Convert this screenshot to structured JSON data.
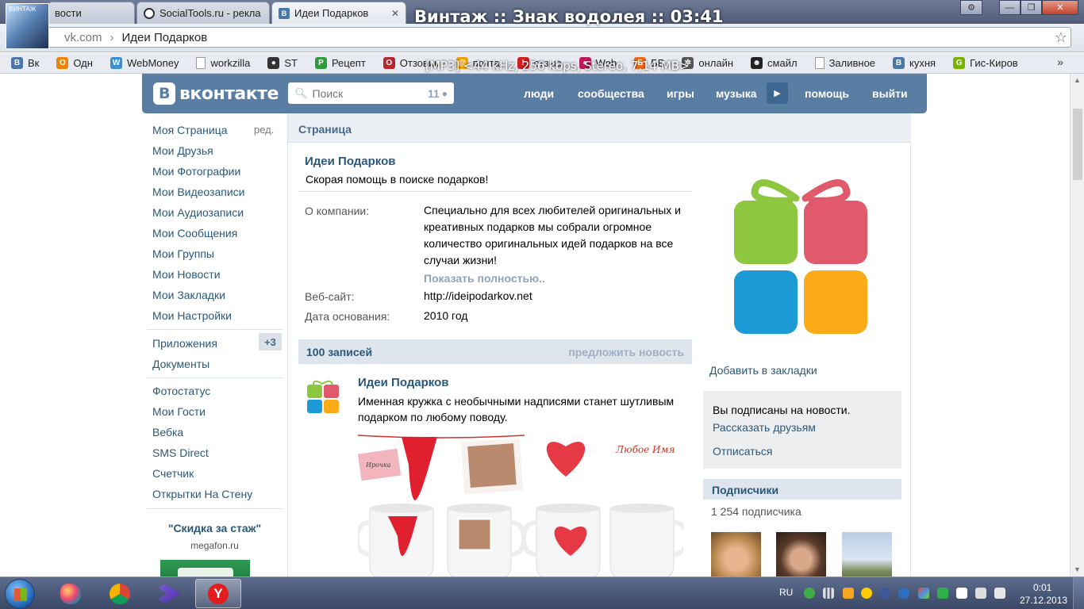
{
  "player": {
    "title": "Винтаж :: Знак водолея :: 03:41",
    "info": "[MP3] <44 kHz, 256 kbps, Stereo, 7,14 MB>",
    "cover_text": "ВИНТАЖ"
  },
  "browser": {
    "tabs": [
      {
        "label": "вости",
        "active": false
      },
      {
        "label": "SocialTools.ru - рекла",
        "active": false
      },
      {
        "label": "Идеи Подарков",
        "active": true
      }
    ],
    "address": {
      "host": "vk.com",
      "separator": "›",
      "page_title": "Идеи Подарков"
    },
    "bookmarks": [
      {
        "label": "Вк",
        "icon": "vk-icon",
        "color": "#4a76a8",
        "glyph": "В"
      },
      {
        "label": "Одн",
        "icon": "ok-icon",
        "color": "#ee8208",
        "glyph": "О"
      },
      {
        "label": "WebMoney",
        "icon": "webmoney-icon",
        "color": "#3a8fd0",
        "glyph": "W"
      },
      {
        "label": "workzilla",
        "icon": "page-icon",
        "color": "#ffffff",
        "glyph": ""
      },
      {
        "label": "ST",
        "icon": "st-icon",
        "color": "#333333",
        "glyph": "●"
      },
      {
        "label": "Рецепт",
        "icon": "recipe-icon",
        "color": "#2e9c3c",
        "glyph": "Р"
      },
      {
        "label": "Отзовик",
        "icon": "otzovik-icon",
        "color": "#b5282e",
        "glyph": "О"
      },
      {
        "label": "почта",
        "icon": "mail-icon",
        "color": "#f0a000",
        "glyph": "@"
      },
      {
        "label": "отзыв",
        "icon": "review-icon",
        "color": "#d11f1f",
        "glyph": "!"
      },
      {
        "label": "Web",
        "icon": "web-icon",
        "color": "#c2185b",
        "glyph": "●"
      },
      {
        "label": "БВ",
        "icon": "bv-icon",
        "color": "#f06a1a",
        "glyph": "Б"
      },
      {
        "label": "онлайн",
        "icon": "online-icon",
        "color": "#555555",
        "glyph": "✲"
      },
      {
        "label": "смайл",
        "icon": "smile-icon",
        "color": "#222222",
        "glyph": "☻"
      },
      {
        "label": "Заливное",
        "icon": "page-icon",
        "color": "#ffffff",
        "glyph": ""
      },
      {
        "label": "кухня",
        "icon": "vk-icon",
        "color": "#4a76a8",
        "glyph": "В"
      },
      {
        "label": "Гис-Киров",
        "icon": "gis-icon",
        "color": "#77b300",
        "glyph": "G"
      }
    ],
    "bookmarks_more": "»"
  },
  "vk": {
    "logo": "вконтакте",
    "search": {
      "placeholder": "Поиск",
      "count": "11"
    },
    "nav": {
      "people": "люди",
      "communities": "сообщества",
      "games": "игры",
      "music": "музыка",
      "help": "помощь",
      "logout": "выйти"
    },
    "left_menu": {
      "items": [
        "Моя Страница",
        "Мои Друзья",
        "Мои Фотографии",
        "Мои Видеозаписи",
        "Мои Аудиозаписи",
        "Мои Сообщения",
        "Мои Группы",
        "Мои Новости",
        "Мои Закладки",
        "Мои Настройки"
      ],
      "edit": "ред.",
      "apps": "Приложения",
      "apps_badge": "+3",
      "docs": "Документы",
      "extra": [
        "Фотостатус",
        "Мои Гости",
        "Вебка",
        "SMS Direct",
        "Счетчик",
        "Открытки На Стену"
      ],
      "ad_title": "\"Скидка за стаж\"",
      "ad_domain": "megafon.ru"
    },
    "page_header": "Страница",
    "group": {
      "name": "Идеи Подарков",
      "status": "Скорая помощь в поиске подарков!",
      "about_label": "О компании:",
      "about_text": "Специально для всех любителей оригинальных и креативных подарков мы собрали огромное количество оригинальных идей подарков на все случаи жизни!",
      "show_more": "Показать полностью..",
      "website_label": "Веб-сайт:",
      "website": "http://ideipodarkov.net",
      "founded_label": "Дата основания:",
      "founded": "2010 год"
    },
    "wall": {
      "count": "100 записей",
      "suggest": "предложить новость",
      "post": {
        "author": "Идеи Подарков",
        "text": "Именная кружка с необычными надписями станет шутливым подарком по любому поводу.",
        "mug_text_1": "Ирочка",
        "mug_text_2": "Любое Имя"
      }
    },
    "sidebar": {
      "add_bookmark": "Добавить в закладки",
      "subscribed": "Вы подписаны на новости.",
      "tell_friends": "Рассказать друзьям",
      "unsubscribe": "Отписаться",
      "followers_title": "Подписчики",
      "followers_count": "1 254 подписчика"
    }
  },
  "taskbar": {
    "lang": "RU",
    "time": "0:01",
    "date": "27.12.2013"
  },
  "colors": {
    "vk_header": "#597da3",
    "vk_link": "#2b587a",
    "gift_green": "#8dc63f",
    "gift_red": "#e05a6b",
    "gift_blue": "#1b9ad6",
    "gift_orange": "#fbab18"
  }
}
